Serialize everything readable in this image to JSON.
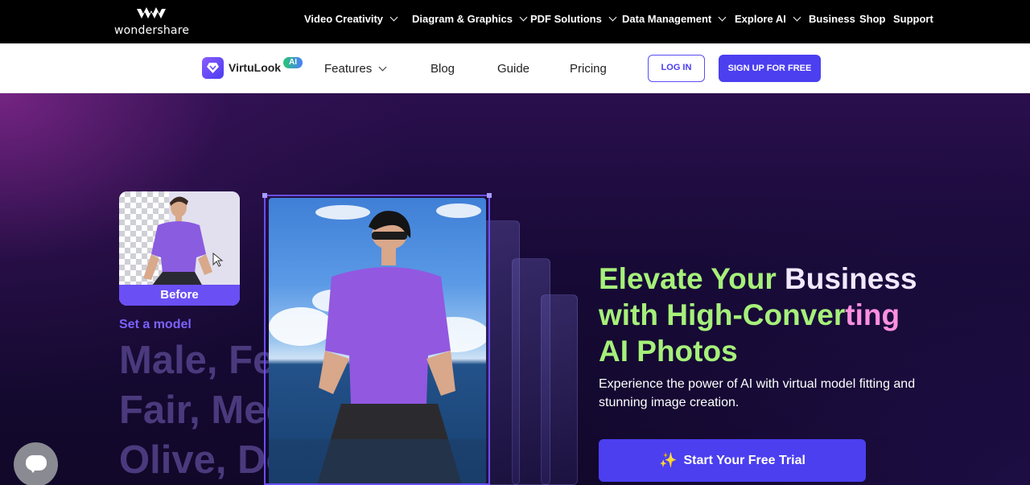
{
  "topbar": {
    "brand": "wondershare",
    "nav": [
      {
        "label": "Video Creativity",
        "has_caret": true
      },
      {
        "label": "Diagram & Graphics",
        "has_caret": true
      },
      {
        "label": "PDF Solutions",
        "has_caret": true
      },
      {
        "label": "Data Management",
        "has_caret": true
      },
      {
        "label": "Explore AI",
        "has_caret": true
      },
      {
        "label": "Business",
        "has_caret": false
      },
      {
        "label": "Shop",
        "has_caret": false
      },
      {
        "label": "Support",
        "has_caret": false
      }
    ]
  },
  "product_bar": {
    "name": "VirtuLook",
    "badge": "AI",
    "nav": [
      {
        "label": "Features",
        "has_caret": true
      },
      {
        "label": "Blog"
      },
      {
        "label": "Guide"
      },
      {
        "label": "Pricing"
      }
    ],
    "login_label": "LOG IN",
    "signup_label": "SIGN UP FOR FREE"
  },
  "hero": {
    "before_label": "Before",
    "set_model": "Set a model",
    "model_options": [
      "Male, Female,",
      "Fair, Medium,",
      "Olive, Deep,"
    ],
    "headline": {
      "line1a": "Elevate Your ",
      "line1b": "Business",
      "line2a": "with High-Conver",
      "line2b": "ting",
      "line3": "AI Photos"
    },
    "subtext": "Experience the power of AI with virtual model fitting and stunning image creation.",
    "cta_label": "Start Your Free Trial"
  },
  "colors": {
    "accent": "#4b3ff0",
    "headline_green": "#a6f07a",
    "headline_pink": "#ff8fe1",
    "model_text": "#4a3a7d"
  },
  "icons": [
    "wondershare-logo-icon",
    "virtulook-logo-icon",
    "chevron-down-icon",
    "cursor-icon",
    "sparkle-icon",
    "chat-icon"
  ]
}
